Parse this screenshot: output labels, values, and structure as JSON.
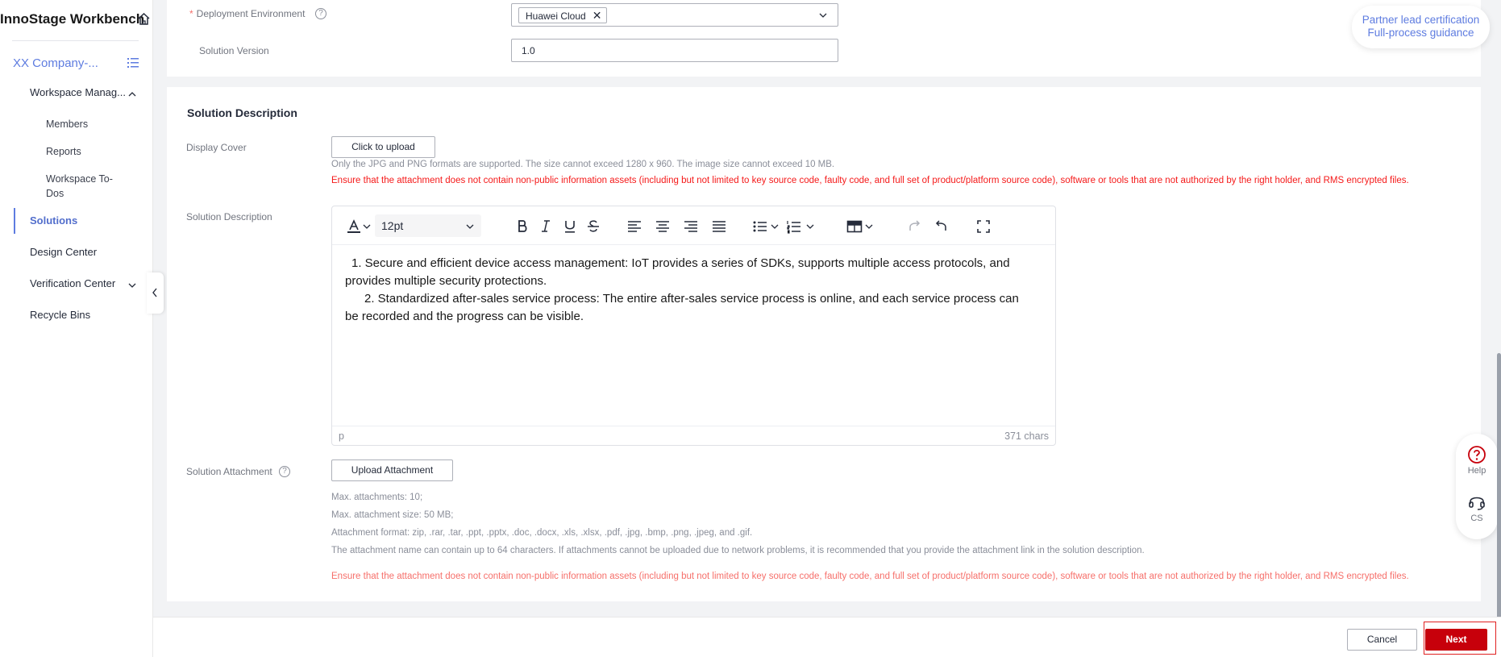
{
  "sidebar": {
    "title": "InnoStage Workbench",
    "company": "XX Company-...",
    "workspace_management": "Workspace Manag...",
    "members": "Members",
    "reports": "Reports",
    "workspace_todos_line1": "Workspace To-",
    "workspace_todos_line2": "Dos",
    "solutions": "Solutions",
    "design_center": "Design Center",
    "verification_center": "Verification Center",
    "recycle_bins": "Recycle Bins"
  },
  "form_top": {
    "required_mark": "*",
    "deployment_label": "Deployment Environment",
    "deployment_value": "Huawei Cloud",
    "version_label": "Solution Version",
    "version_value": "1.0"
  },
  "description_section": {
    "title": "Solution Description",
    "display_cover_label": "Display Cover",
    "upload_button": "Click to upload",
    "cover_hint": "Only the JPG and PNG formats are supported. The size cannot exceed 1280 x 960. The image size cannot exceed 10 MB.",
    "cover_warning": "Ensure that the attachment does not contain non-public information assets (including but not limited to key source code, faulty code, and full set of product/platform source code), software or tools that are not authorized by the right holder, and RMS encrypted files.",
    "description_label": "Solution Description",
    "editor": {
      "font_size": "12pt",
      "line1": "1. Secure and efficient device access management: IoT provides a series of SDKs, supports multiple access protocols, and",
      "line2": "provides multiple security protections.",
      "line3": "2. Standardized after-sales service process: The entire after-sales service process is online, and each service process can",
      "line4": "be recorded and the progress can be visible.",
      "element_path": "p",
      "char_count": "371 chars"
    },
    "attachment_label": "Solution Attachment",
    "upload_attachment_button": "Upload Attachment",
    "hint_max_count": "Max. attachments: 10;",
    "hint_max_size": "Max. attachment size: 50 MB;",
    "hint_format": "Attachment format: zip, .rar, .tar, .ppt, .pptx, .doc, .docx, .xls, .xlsx, .pdf, .jpg, .bmp, .png, .jpeg, and .gif.",
    "hint_name": "The attachment name can contain up to 64 characters. If attachments cannot be uploaded due to network problems, it is recommended that you provide the attachment link in the solution description.",
    "attachment_warning": "Ensure that the attachment does not contain non-public information assets (including but not limited to key source code, faulty code, and full set of product/platform source code), software or tools that are not authorized by the right holder, and RMS encrypted files."
  },
  "footer": {
    "cancel": "Cancel",
    "next": "Next"
  },
  "floating": {
    "partner_line1": "Partner lead certification",
    "partner_line2": "Full-process guidance",
    "help": "Help",
    "cs": "CS"
  },
  "colors": {
    "accent": "#5e7ce0",
    "primary_button": "#c7000b",
    "warning_text": "#f51919"
  }
}
